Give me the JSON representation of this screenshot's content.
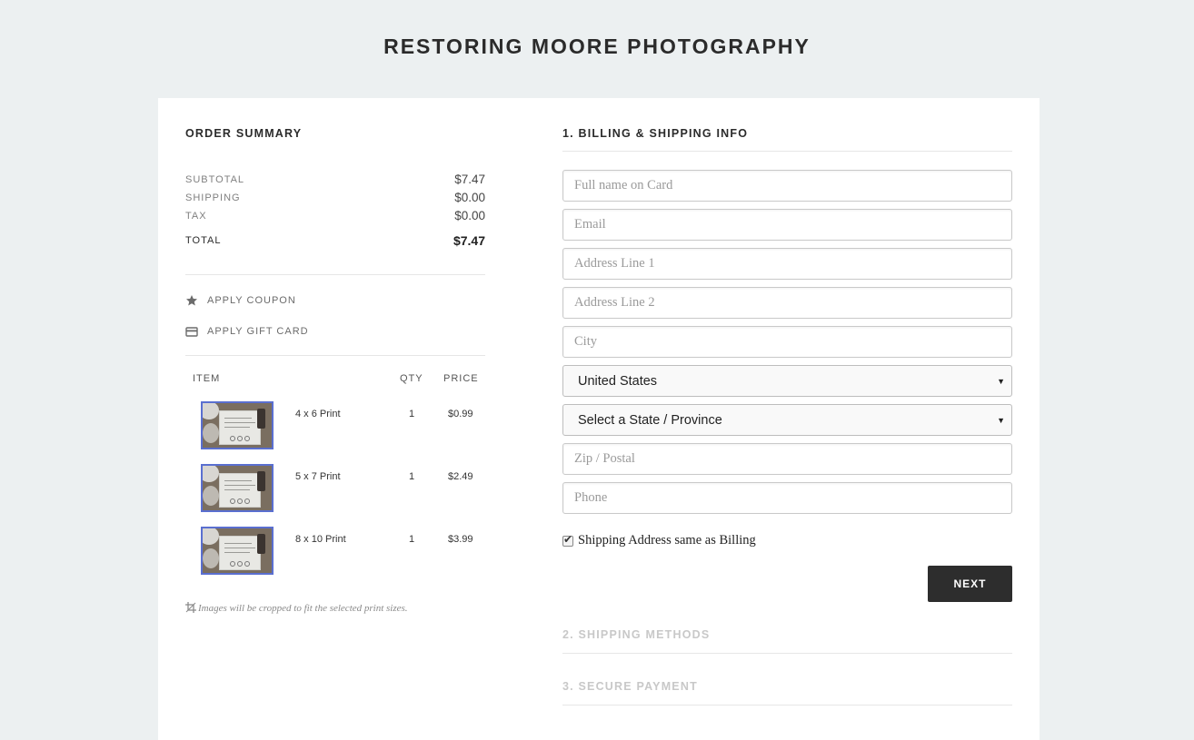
{
  "site": {
    "title": "RESTORING MOORE PHOTOGRAPHY"
  },
  "summary": {
    "heading": "ORDER SUMMARY",
    "subtotal_label": "SUBTOTAL",
    "subtotal": "$7.47",
    "shipping_label": "SHIPPING",
    "shipping": "$0.00",
    "tax_label": "TAX",
    "tax": "$0.00",
    "total_label": "TOTAL",
    "total": "$7.47"
  },
  "actions": {
    "coupon": "APPLY COUPON",
    "gift_card": "APPLY GIFT CARD"
  },
  "items_table": {
    "headers": {
      "item": "ITEM",
      "qty": "QTY",
      "price": "PRICE"
    },
    "rows": [
      {
        "name": "4 x 6 Print",
        "qty": "1",
        "price": "$0.99"
      },
      {
        "name": "5 x 7 Print",
        "qty": "1",
        "price": "$2.49"
      },
      {
        "name": "8 x 10 Print",
        "qty": "1",
        "price": "$3.99"
      }
    ]
  },
  "crop_note": "Images will be cropped to fit the selected print sizes.",
  "billing": {
    "heading": "1. BILLING & SHIPPING INFO",
    "full_name_placeholder": "Full name on Card",
    "email_placeholder": "Email",
    "address1_placeholder": "Address Line 1",
    "address2_placeholder": "Address Line 2",
    "city_placeholder": "City",
    "country_value": "United States",
    "state_value": "Select a State / Province",
    "zip_placeholder": "Zip / Postal",
    "phone_placeholder": "Phone",
    "same_address_label": "Shipping Address same as Billing",
    "same_address_checked": true,
    "next_label": "NEXT"
  },
  "steps": {
    "shipping_methods": "2. SHIPPING METHODS",
    "secure_payment": "3. SECURE PAYMENT"
  },
  "colors": {
    "background": "#ecf0f1",
    "button": "#2d2d2d",
    "thumb_border": "#5a6fd0"
  }
}
